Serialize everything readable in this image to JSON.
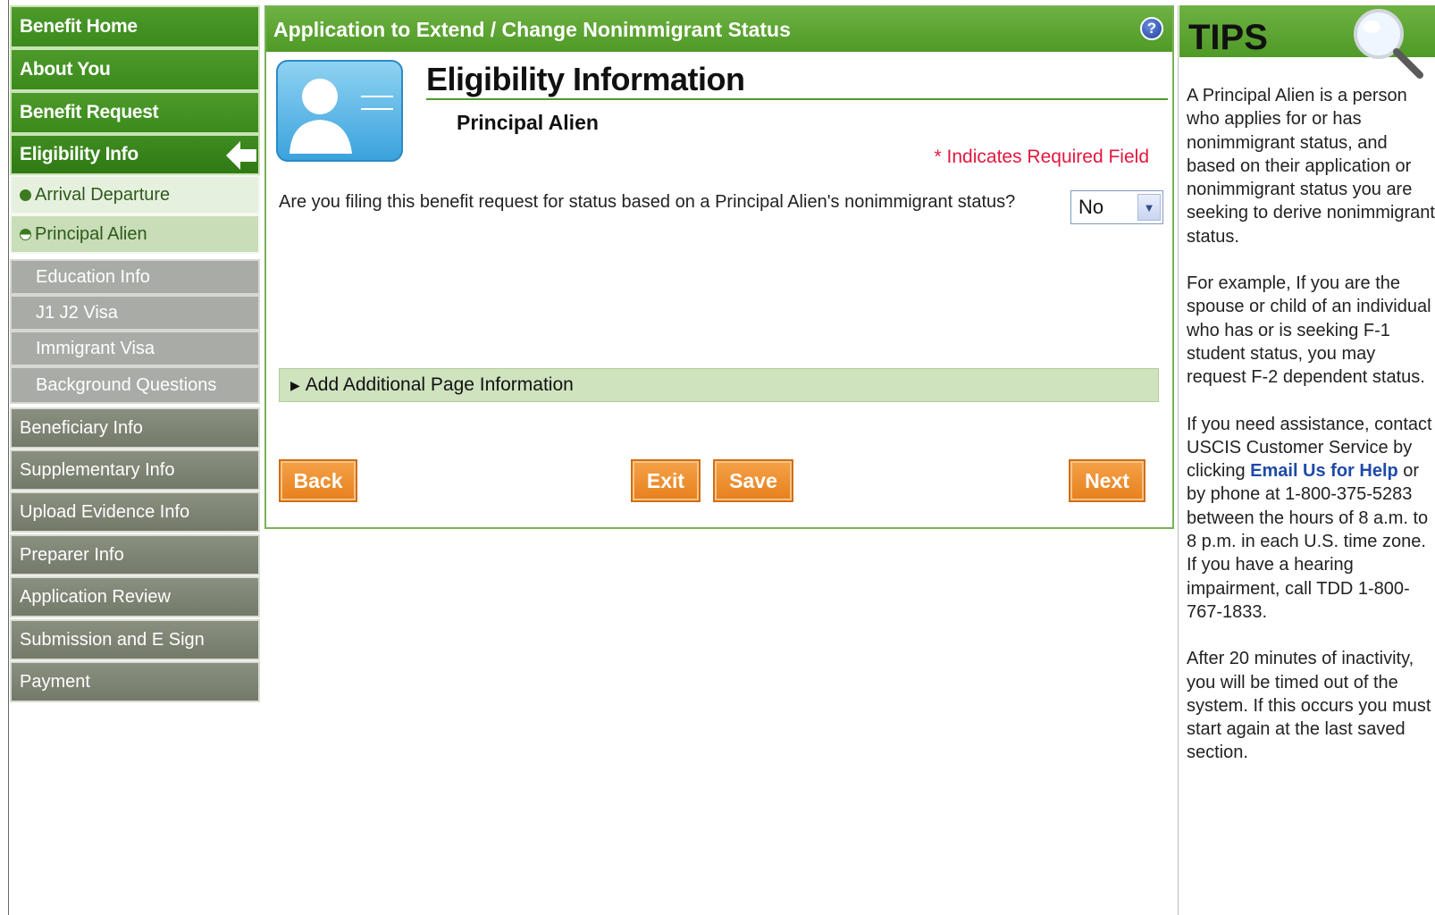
{
  "sidebar": {
    "items": [
      {
        "label": "Benefit Home"
      },
      {
        "label": "About You"
      },
      {
        "label": "Benefit Request"
      },
      {
        "label": "Eligibility Info"
      },
      {
        "label": "Arrival Departure"
      },
      {
        "label": "Principal Alien"
      },
      {
        "label": "Education Info"
      },
      {
        "label": "J1 J2 Visa"
      },
      {
        "label": "Immigrant Visa"
      },
      {
        "label": "Background Questions"
      },
      {
        "label": "Beneficiary Info"
      },
      {
        "label": "Supplementary Info"
      },
      {
        "label": "Upload Evidence Info"
      },
      {
        "label": "Preparer Info"
      },
      {
        "label": "Application Review"
      },
      {
        "label": "Submission and E Sign"
      },
      {
        "label": "Payment"
      }
    ]
  },
  "main": {
    "header_title": "Application to Extend / Change Nonimmigrant Status",
    "help_icon": "?",
    "section_title": "Eligibility Information",
    "subsection_title": "Principal Alien",
    "required_note": "* Indicates Required Field",
    "question": "Are you filing this benefit request for status based on a Principal Alien's nonimmigrant status?",
    "answer_value": "No",
    "add_info_label": "Add Additional Page Information",
    "buttons": {
      "back": "Back",
      "exit": "Exit",
      "save": "Save",
      "next": "Next"
    }
  },
  "tips": {
    "title": "TIPS",
    "p1": "A Principal Alien is a person who applies for or has nonimmigrant status, and based on their application or nonimmigrant status you are seeking to derive nonimmigrant status.",
    "p2": "For example, If you are the spouse or child of an individual who has or is seeking F-1 student status, you may request F-2 dependent status.",
    "p3_before": "If you need assistance, contact USCIS Customer Service by clicking ",
    "p3_link": "Email Us for Help",
    "p3_after": " or by phone at 1-800-375-5283 between the hours of 8 a.m. to 8 p.m. in each U.S. time zone. If you have a hearing impairment, call TDD 1-800-767-1833.",
    "p4": "After 20 minutes of inactivity, you will be timed out of the system. If this occurs you must start again at the last saved section."
  },
  "colors": {
    "header_green": "#5aa331",
    "accent_orange": "#ec8a22",
    "required_red": "#e4173d",
    "link_blue": "#1e4aa8"
  }
}
